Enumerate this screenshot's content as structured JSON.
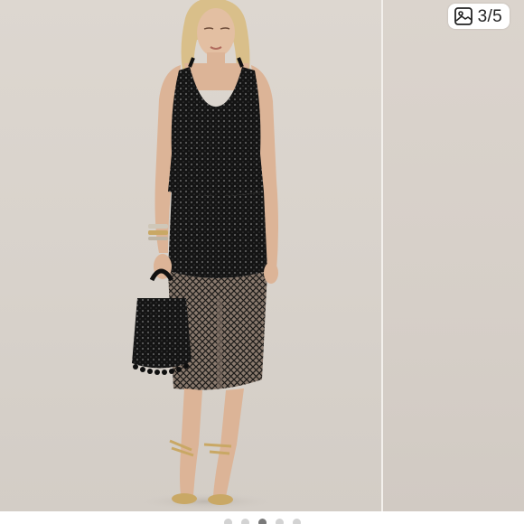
{
  "viewer": {
    "counter_text": "3/5",
    "counter_icon": "image-icon",
    "total_images": 5,
    "current_index": 3
  },
  "dots": [
    {
      "active": false
    },
    {
      "active": false
    },
    {
      "active": true
    },
    {
      "active": false
    },
    {
      "active": false
    }
  ],
  "colors": {
    "background": "#ddd7d0",
    "dot_active": "#7a7a7a",
    "dot_inactive": "#d3d3d3",
    "badge_bg": "#ffffff"
  }
}
